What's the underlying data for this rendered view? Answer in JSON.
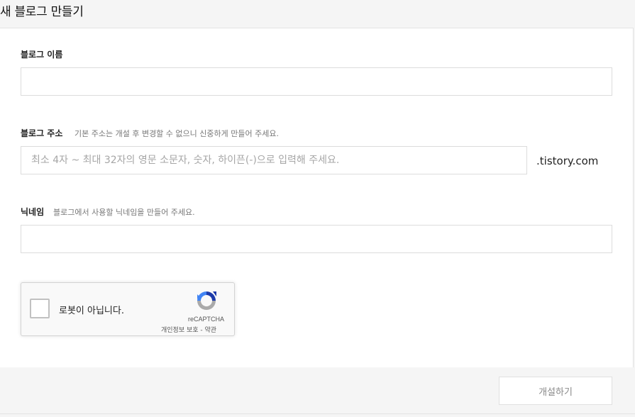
{
  "header": {
    "title": "새 블로그 만들기"
  },
  "form": {
    "blog_name": {
      "label": "블로그 이름",
      "value": "",
      "placeholder": ""
    },
    "blog_address": {
      "label": "블로그 주소",
      "hint": "기본 주소는 개설 후 변경할 수 없으니 신중하게 만들어 주세요.",
      "value": "",
      "placeholder": "최소 4자 ~ 최대 32자의 영문 소문자, 숫자, 하이픈(-)으로 입력해 주세요.",
      "suffix": ".tistory.com"
    },
    "nickname": {
      "label": "닉네임",
      "hint": "블로그에서 사용할 닉네임을 만들어 주세요.",
      "value": "",
      "placeholder": ""
    }
  },
  "recaptcha": {
    "label": "로봇이 아닙니다.",
    "brand": "reCAPTCHA",
    "privacy": "개인정보 보호",
    "separator": " - ",
    "terms": "약관",
    "checked": false,
    "colors": {
      "blue": "#1c3aa9",
      "light_blue": "#4285f4",
      "gray": "#aaaaaa"
    }
  },
  "footer": {
    "submit_label": "개설하기"
  }
}
